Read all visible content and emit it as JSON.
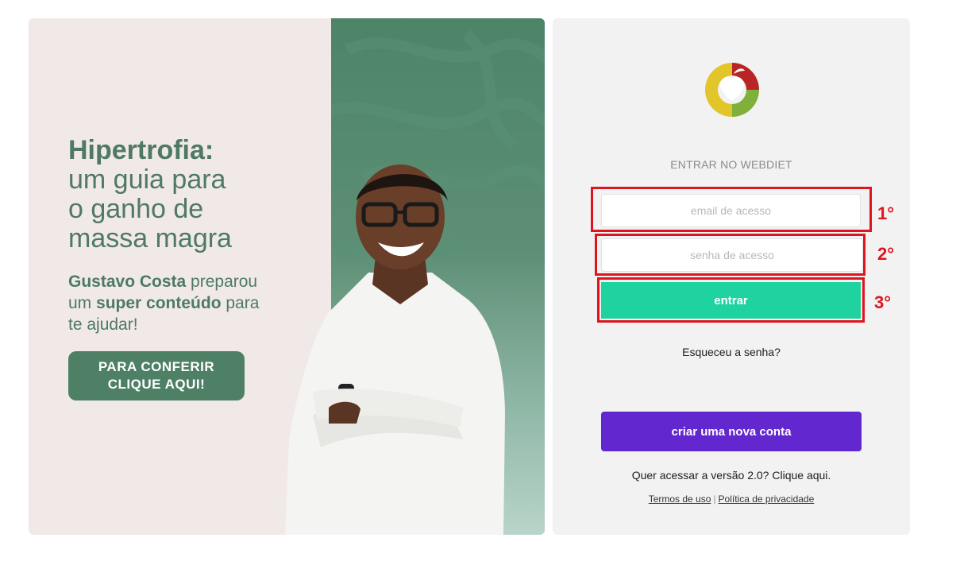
{
  "banner": {
    "headline_bold": "Hipertrofia:",
    "headline_lines": [
      "um guia para",
      "o ganho de",
      "massa magra"
    ],
    "sub_name": "Gustavo Costa",
    "sub_text1": " preparou",
    "sub_text2": "um ",
    "sub_bold2": "super conteúdo",
    "sub_text3": " para",
    "sub_text4": "te ajudar!",
    "cta_line1": "PARA CONFERIR",
    "cta_line2": "CLIQUE AQUI!"
  },
  "login": {
    "title": "ENTRAR NO WEBDIET",
    "email_placeholder": "email de acesso",
    "password_placeholder": "senha de acesso",
    "submit_label": "entrar",
    "forgot_label": "Esqueceu a senha?",
    "create_account_label": "criar uma nova conta",
    "v2_text": "Quer acessar a versão 2.0? ",
    "v2_link": "Clique aqui.",
    "terms_label": "Termos de uso",
    "separator": "|",
    "privacy_label": "Política de privacidade"
  },
  "annotations": {
    "step1": "1°",
    "step2": "2°",
    "step3": "3°"
  },
  "colors": {
    "brand_green": "#4e8066",
    "submit_green": "#1fd3a0",
    "create_purple": "#6327d0",
    "annotation_red": "#e0141e"
  }
}
